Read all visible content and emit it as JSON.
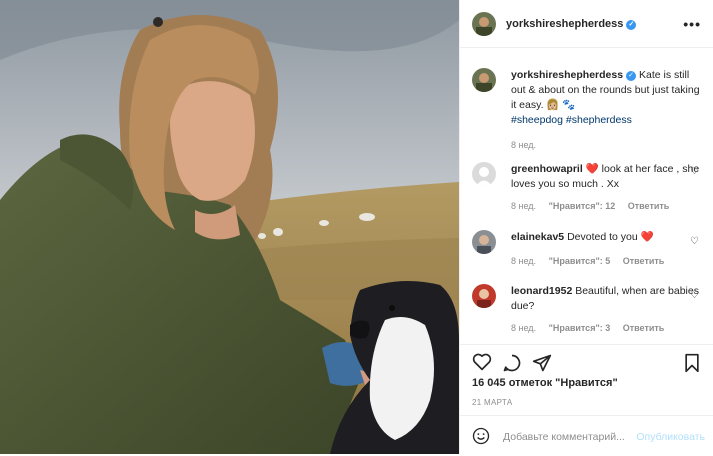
{
  "post": {
    "author": "yorkshireshepherdess",
    "more_label": "•••"
  },
  "caption": {
    "username": "yorkshireshepherdess",
    "text": "Kate is still out & about on the rounds but just taking it easy. 👩🏼 🐾",
    "hashtags": "#sheepdog #shepherdess",
    "time": "8 нед."
  },
  "comments": [
    {
      "username": "greenhowapril",
      "text": "❤️ look at her face , she loves you so much . Xx",
      "time": "8 нед.",
      "likes": "\"Нравится\": 12",
      "reply": "Ответить"
    },
    {
      "username": "elainekav5",
      "text": "Devoted to you ❤️",
      "time": "8 нед.",
      "likes": "\"Нравится\": 5",
      "reply": "Ответить"
    },
    {
      "username": "leonard1952",
      "text": "Beautiful, when are babies due?",
      "time": "8 нед.",
      "likes": "\"Нравится\": 3",
      "reply": "Ответить"
    }
  ],
  "stats": {
    "likes_text": "16 045 отметок \"Нравится\"",
    "date": "21 МАРТА"
  },
  "composer": {
    "placeholder": "Добавьте комментарий...",
    "publish": "Опубликовать"
  },
  "colors": {
    "accent": "#3897f0",
    "link": "#00376b",
    "muted": "#8e8e8e",
    "publish_disabled": "#b2dffc"
  }
}
